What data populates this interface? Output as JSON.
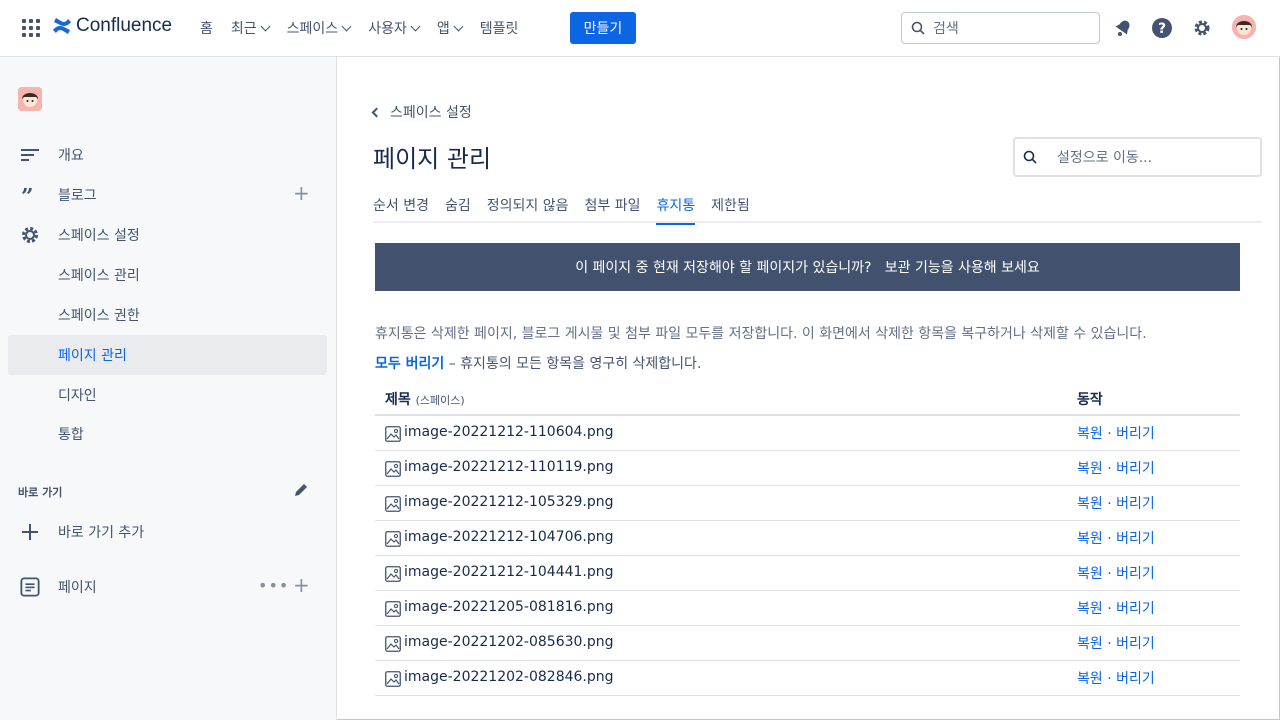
{
  "topbar": {
    "app_name": "Confluence",
    "nav": [
      {
        "label": "홈",
        "has_menu": false
      },
      {
        "label": "최근",
        "has_menu": true
      },
      {
        "label": "스페이스",
        "has_menu": true
      },
      {
        "label": "사용자",
        "has_menu": true
      },
      {
        "label": "앱",
        "has_menu": true
      },
      {
        "label": "템플릿",
        "has_menu": false
      }
    ],
    "create_label": "만들기",
    "search_placeholder": "검색",
    "accent": "#0C66E4"
  },
  "sidebar": {
    "items": [
      {
        "label": "개요",
        "icon": "overview-icon"
      },
      {
        "label": "블로그",
        "icon": "quote-icon"
      },
      {
        "label": "스페이스 설정",
        "icon": "gear-icon"
      },
      {
        "label": "스페이스 관리"
      },
      {
        "label": "스페이스 권한"
      },
      {
        "label": "페이지 관리",
        "active": true
      },
      {
        "label": "디자인"
      },
      {
        "label": "통합"
      }
    ],
    "shortcuts_label": "바로 가기",
    "add_shortcut_label": "바로 가기 추가",
    "pages_label": "페이지"
  },
  "main": {
    "back_label": "스페이스 설정",
    "title": "페이지 관리",
    "settings_search_placeholder": "설정으로 이동...",
    "tabs": [
      {
        "label": "순서 변경"
      },
      {
        "label": "숨김"
      },
      {
        "label": "정의되지 않음"
      },
      {
        "label": "첨부 파일"
      },
      {
        "label": "휴지통",
        "active": true
      },
      {
        "label": "제한됨"
      }
    ],
    "banner": "이 페이지 중 현재 저장해야 할 페이지가 있습니까?   보관 기능을 사용해 보세요",
    "description": "휴지통은 삭제한 페이지, 블로그 게시물 및 첨부 파일 모두를 저장합니다. 이 화면에서 삭제한 항목을 복구하거나 삭제할 수 있습니다.",
    "purge_link": "모두 버리기",
    "purge_text": " – 휴지통의 모든 항목을 영구히 삭제합니다.",
    "table": {
      "col_title": "제목",
      "col_title_sub": "(스페이스)",
      "col_actions": "동작",
      "restore_label": "복원",
      "separator": " · ",
      "purge_label": "버리기",
      "rows": [
        "image-20221212-110604.png",
        "image-20221212-110119.png",
        "image-20221212-105329.png",
        "image-20221212-104706.png",
        "image-20221212-104441.png",
        "image-20221205-081816.png",
        "image-20221202-085630.png",
        "image-20221202-082846.png"
      ]
    }
  }
}
